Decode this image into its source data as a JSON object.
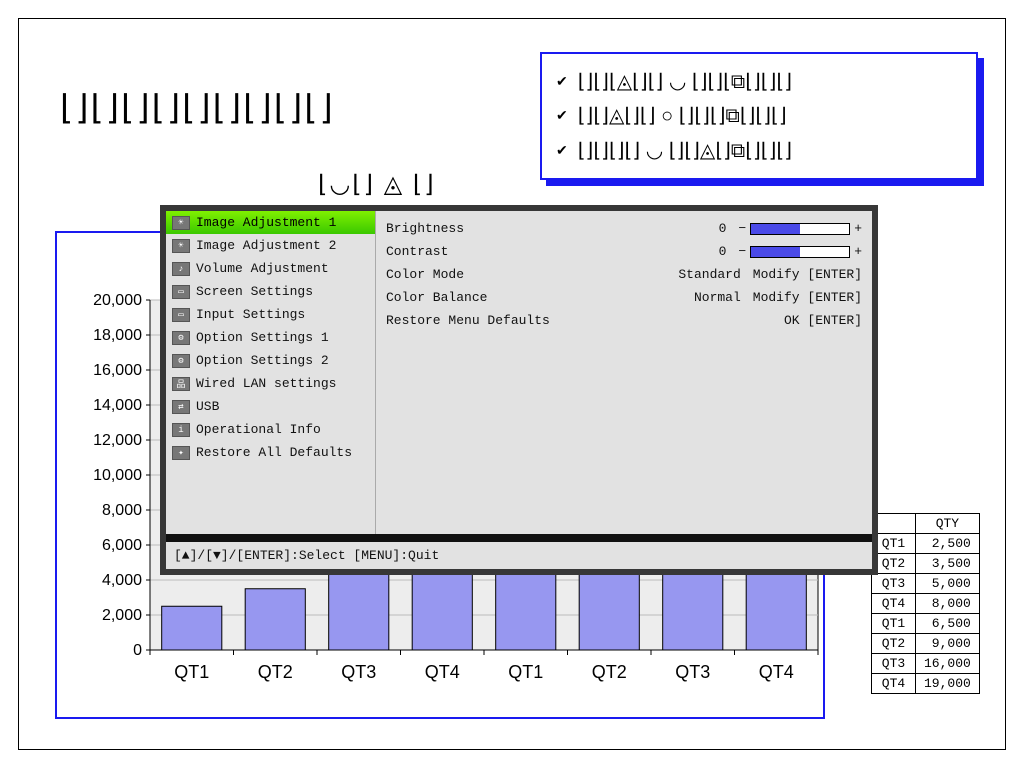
{
  "glyph_row_1": "⌊⌋⌊⌋⌊⌋⌊⌋⌊⌋⌊⌋⌊⌋⌊⌋⌊⌋",
  "glyph_row_2": "⌊◡⌊⌋ ◬ ⌊⌋",
  "options": [
    "⌊⌋⌊⌋⌊◬⌊⌋⌊⌋ ◡ ⌊⌋⌊⌋⌊⧉⌊⌋⌊⌋⌊⌋",
    "⌊⌋⌊⌋◬⌊⌋⌊⌋ ○ ⌊⌋⌊⌋⌊⌋⧉⌊⌋⌊⌋⌊⌋",
    "⌊⌋⌊⌋⌊⌋⌊⌋ ◡ ⌊⌋⌊⌋◬⌊⌋⧉⌊⌋⌊⌋⌊⌋"
  ],
  "osd": {
    "menu": [
      {
        "label": "Image Adjustment 1",
        "icon": "☀"
      },
      {
        "label": "Image Adjustment 2",
        "icon": "☀"
      },
      {
        "label": "Volume Adjustment",
        "icon": "♪"
      },
      {
        "label": "Screen Settings",
        "icon": "▭"
      },
      {
        "label": "Input Settings",
        "icon": "▭"
      },
      {
        "label": "Option Settings 1",
        "icon": "⚙"
      },
      {
        "label": "Option Settings 2",
        "icon": "⚙"
      },
      {
        "label": "Wired LAN settings",
        "icon": "品"
      },
      {
        "label": "USB",
        "icon": "⇄"
      },
      {
        "label": "Operational Info",
        "icon": "i"
      },
      {
        "label": "Restore All Defaults",
        "icon": "✦"
      }
    ],
    "selected_index": 0,
    "right": {
      "brightness_label": "Brightness",
      "brightness_val": "0",
      "contrast_label": "Contrast",
      "contrast_val": "0",
      "colormode_label": "Color Mode",
      "colormode_val": "Standard",
      "modify": "Modify [ENTER]",
      "colorbal_label": "Color Balance",
      "colorbal_val": "Normal",
      "restore_label": "Restore Menu Defaults",
      "ok": "OK [ENTER]"
    },
    "footer": "[▲]/[▼]/[ENTER]:Select  [MENU]:Quit"
  },
  "table": {
    "header": "QTY",
    "rows": [
      {
        "cat": "QT1",
        "val": "2,500"
      },
      {
        "cat": "QT2",
        "val": "3,500"
      },
      {
        "cat": "QT3",
        "val": "5,000"
      },
      {
        "cat": "QT4",
        "val": "8,000"
      },
      {
        "cat": "QT1",
        "val": "6,500"
      },
      {
        "cat": "QT2",
        "val": "9,000"
      },
      {
        "cat": "QT3",
        "val": "16,000"
      },
      {
        "cat": "QT4",
        "val": "19,000"
      }
    ]
  },
  "chart_data": {
    "type": "bar",
    "categories": [
      "QT1",
      "QT2",
      "QT3",
      "QT4",
      "QT1",
      "QT2",
      "QT3",
      "QT4"
    ],
    "values": [
      2500,
      3500,
      5000,
      8000,
      6500,
      9000,
      16000,
      19000
    ],
    "ylim": [
      0,
      20000
    ],
    "yticks": [
      0,
      2000,
      4000,
      6000,
      8000,
      10000,
      12000,
      14000,
      16000,
      18000,
      20000
    ],
    "ytick_labels": [
      "0",
      "2,000",
      "4,000",
      "6,000",
      "8,000",
      "10,000",
      "12,000",
      "14,000",
      "16,000",
      "18,000",
      "20,000"
    ],
    "title": "",
    "xlabel": "",
    "ylabel": "",
    "bar_fill": "#9797F0",
    "bar_stroke": "#000"
  }
}
